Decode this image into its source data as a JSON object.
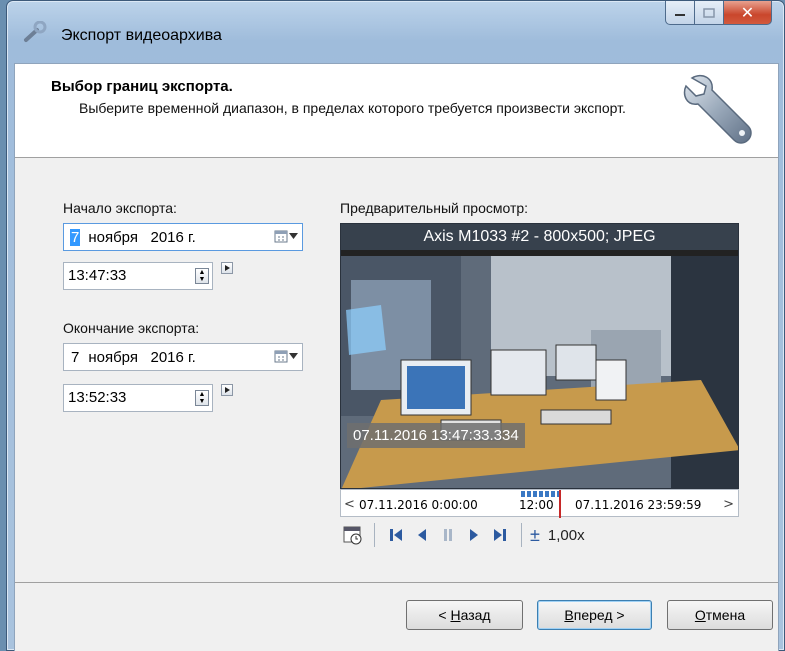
{
  "window": {
    "title": "Экспорт видеоархива"
  },
  "header": {
    "title": "Выбор границ экспорта.",
    "description": "Выберите временной диапазон, в пределах которого требуется произвести экспорт."
  },
  "start": {
    "label": "Начало экспорта:",
    "day": "7",
    "month_year": "ноября   2016 г.",
    "time": "13:47:33"
  },
  "end": {
    "label": "Окончание экспорта:",
    "day": "7",
    "month_year": "ноября   2016 г.",
    "time": "13:52:33"
  },
  "preview": {
    "label": "Предварительный просмотр:",
    "camera_title": "Axis M1033 #2 - 800x500; JPEG",
    "timestamp": "07.11.2016 13:47:33.334"
  },
  "timeline": {
    "start": "07.11.2016 0:00:00",
    "noon": "12:00",
    "end": "07.11.2016 23:59:59"
  },
  "playback": {
    "speed": "1,00x"
  },
  "buttons": {
    "back_prefix": "< ",
    "back_hotkey": "Н",
    "back_rest": "азад",
    "next_hotkey": "В",
    "next_rest": "перед >",
    "cancel_hotkey": "О",
    "cancel_rest": "тмена"
  },
  "colors": {
    "selection": "#3399ff",
    "accent": "#2c5aa0",
    "cursor": "#c62828"
  }
}
